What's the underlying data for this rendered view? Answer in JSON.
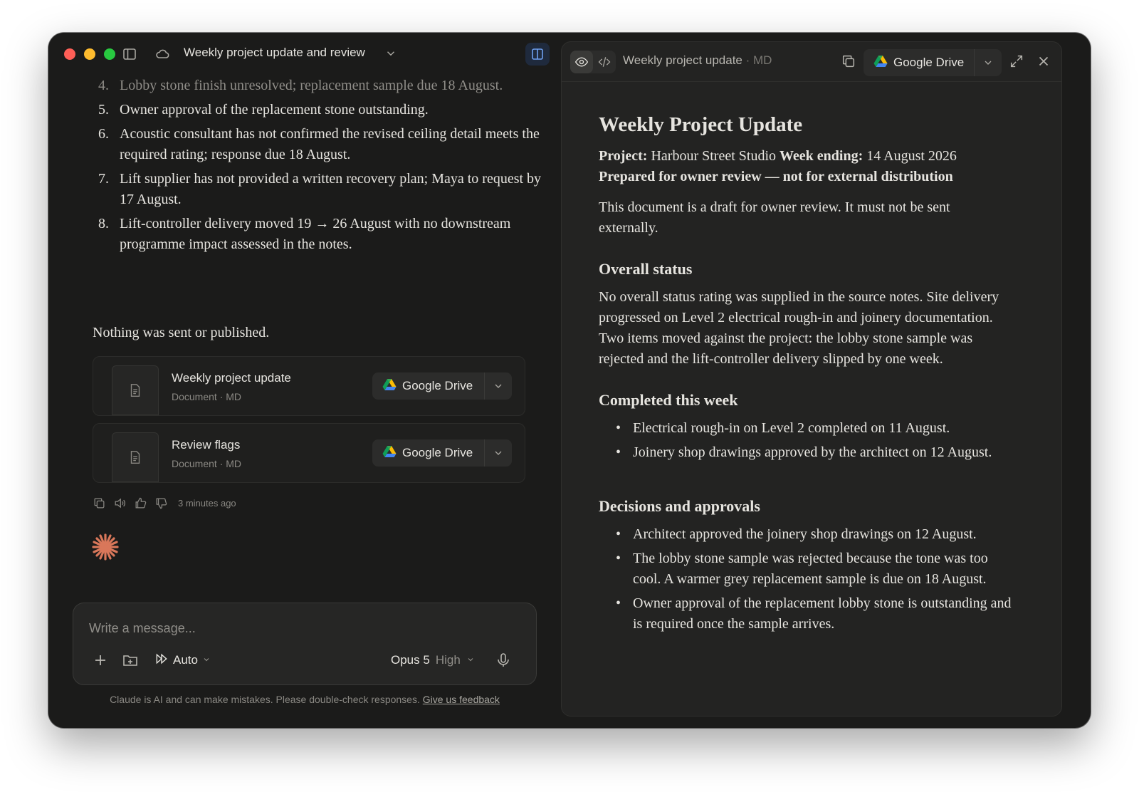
{
  "window": {
    "title": "Weekly project update and review"
  },
  "chat": {
    "list_items": [
      {
        "num": "4.",
        "text": "Lobby stone finish unresolved; replacement sample due 18 August."
      },
      {
        "num": "5.",
        "text": "Owner approval of the replacement stone outstanding."
      },
      {
        "num": "6.",
        "text": "Acoustic consultant has not confirmed the revised ceiling detail meets the required rating; response due 18 August."
      },
      {
        "num": "7.",
        "text": "Lift supplier has not provided a written recovery plan; Maya to request by 17 August."
      },
      {
        "num": "8.",
        "text": "Lift-controller delivery moved 19 → 26 August with no downstream programme impact assessed in the notes."
      }
    ],
    "nothing_sent": "Nothing was sent or published.",
    "files": [
      {
        "name": "Weekly project update",
        "meta": "Document · MD",
        "action": "Google Drive"
      },
      {
        "name": "Review flags",
        "meta": "Document · MD",
        "action": "Google Drive"
      }
    ],
    "timestamp": "3 minutes ago"
  },
  "composer": {
    "placeholder": "Write a message...",
    "mode": "Auto",
    "model": "Opus 5",
    "effort": "High"
  },
  "disclaimer": {
    "text": "Claude is AI and can make mistakes. Please double-check responses.",
    "link": "Give us feedback"
  },
  "document": {
    "title": "Weekly project update",
    "format": "· MD",
    "export_label": "Google Drive",
    "h1": "Weekly Project Update",
    "project_label": "Project:",
    "project_value": "Harbour Street Studio",
    "week_label": "Week ending:",
    "week_value": "14 August 2026",
    "prepared": "Prepared for owner review — not for external distribution",
    "intro": "This document is a draft for owner review. It must not be sent externally.",
    "sections": [
      {
        "heading": "Overall status",
        "paragraph": "No overall status rating was supplied in the source notes. Site delivery progressed on Level 2 electrical rough-in and joinery documentation. Two items moved against the project: the lobby stone sample was rejected and the lift-controller delivery slipped by one week."
      },
      {
        "heading": "Completed this week",
        "bullets": [
          "Electrical rough-in on Level 2 completed on 11 August.",
          "Joinery shop drawings approved by the architect on 12 August."
        ]
      },
      {
        "heading": "Decisions and approvals",
        "bullets": [
          "Architect approved the joinery shop drawings on 12 August.",
          "The lobby stone sample was rejected because the tone was too cool. A warmer grey replacement sample is due on 18 August.",
          "Owner approval of the replacement lobby stone is outstanding and is required once the sample arrives."
        ]
      }
    ]
  },
  "colors": {
    "window_bg": "#1b1b1a",
    "doc_bg": "#232322",
    "accent_spark": "#d9775a",
    "active_panel_toggle": "#6ea0f0"
  }
}
